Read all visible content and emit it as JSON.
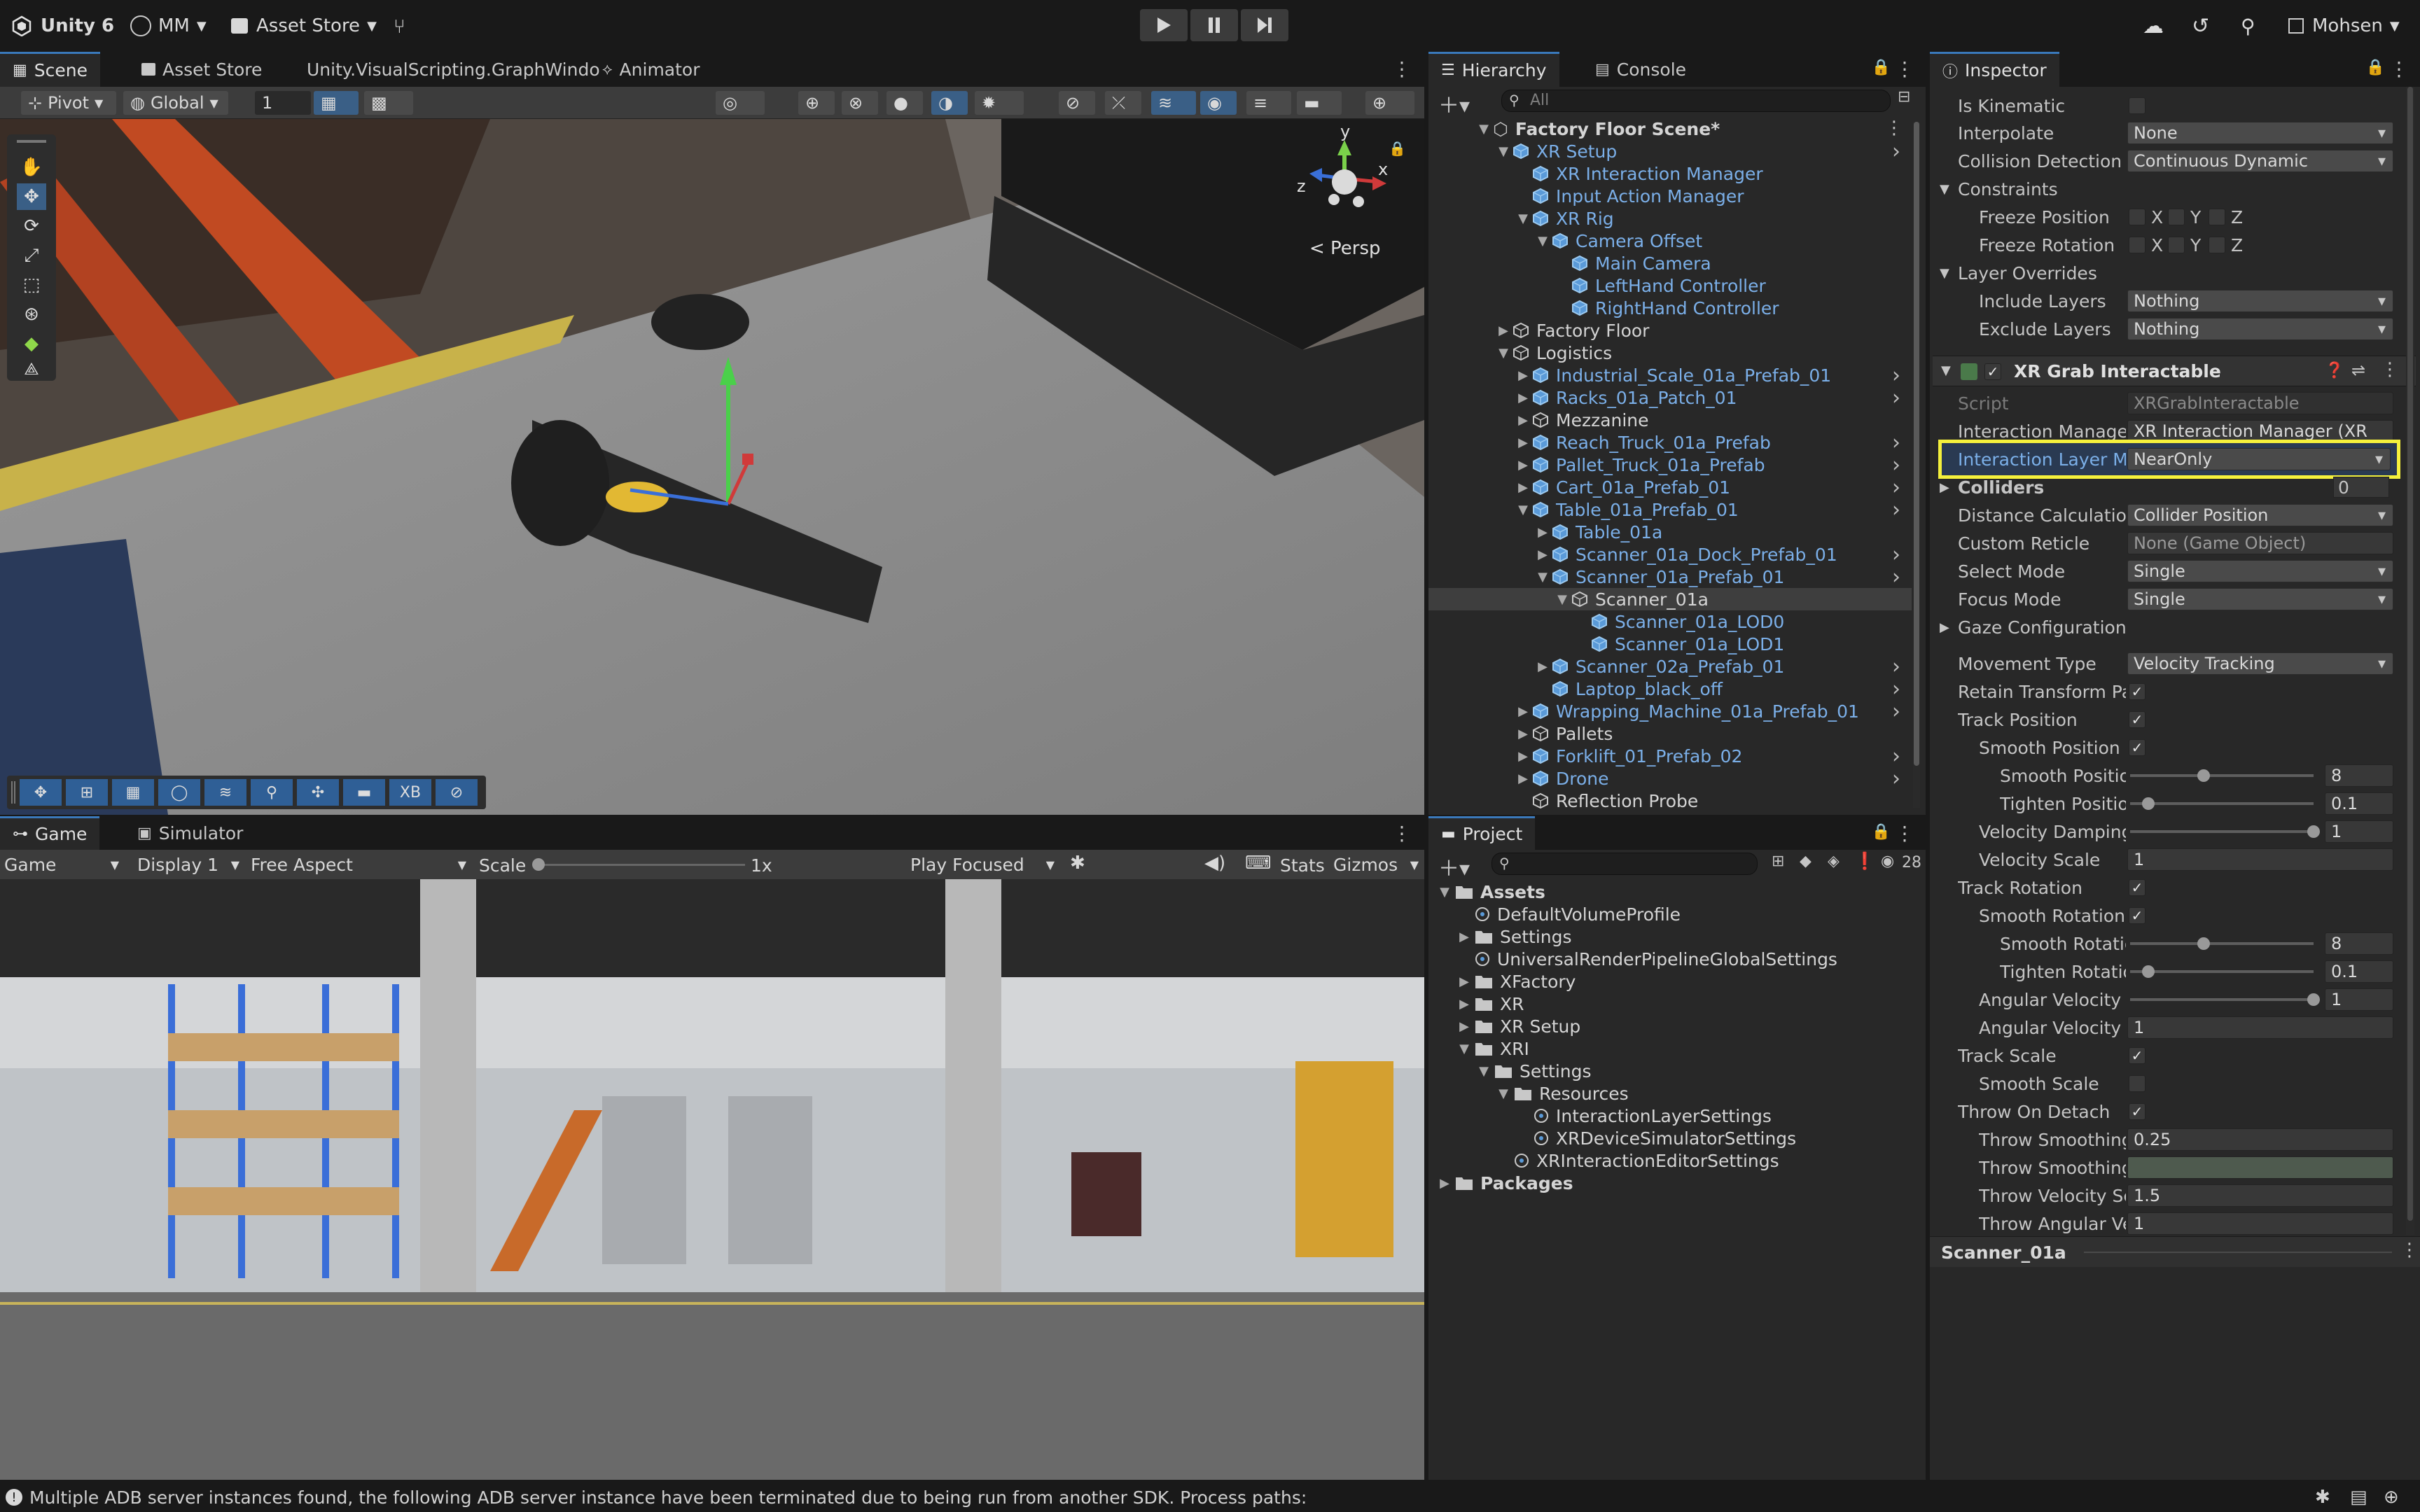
{
  "topbar": {
    "unity_label": "Unity 6",
    "account": "MM",
    "asset_store": "Asset Store",
    "user": "Mohsen"
  },
  "scene": {
    "tabs": [
      "Scene",
      "Asset Store",
      "Unity.VisualScripting.GraphWindo",
      "Animator"
    ],
    "pivot": "Pivot",
    "global": "Global",
    "grid_value": "1",
    "persp_label": "< Persp",
    "gizmo_y": "y",
    "gizmo_x": "x",
    "gizmo_z": "z",
    "overlay_xb": "XB"
  },
  "game": {
    "tabs": [
      "Game",
      "Simulator"
    ],
    "mode": "Game",
    "display": "Display 1",
    "aspect": "Free Aspect",
    "scale_label": "Scale",
    "scale_value": "1x",
    "play_focused": "Play Focused",
    "stats": "Stats",
    "gizmos": "Gizmos"
  },
  "hierarchy": {
    "tabs": [
      "Hierarchy",
      "Console"
    ],
    "search_placeholder": "All",
    "scene_name": "Factory Floor Scene*",
    "items": [
      {
        "label": "XR Setup",
        "depth": 1,
        "blue": true,
        "expand": "open",
        "chev": true
      },
      {
        "label": "XR Interaction Manager",
        "depth": 2,
        "blue": true,
        "expand": "none"
      },
      {
        "label": "Input Action Manager",
        "depth": 2,
        "blue": true,
        "expand": "none"
      },
      {
        "label": "XR Rig",
        "depth": 2,
        "blue": true,
        "expand": "open"
      },
      {
        "label": "Camera Offset",
        "depth": 3,
        "blue": true,
        "expand": "open"
      },
      {
        "label": "Main Camera",
        "depth": 4,
        "blue": true,
        "expand": "none"
      },
      {
        "label": "LeftHand Controller",
        "depth": 4,
        "blue": true,
        "expand": "none"
      },
      {
        "label": "RightHand Controller",
        "depth": 4,
        "blue": true,
        "expand": "none"
      },
      {
        "label": "Factory Floor",
        "depth": 1,
        "blue": false,
        "expand": "closed"
      },
      {
        "label": "Logistics",
        "depth": 1,
        "blue": false,
        "expand": "open"
      },
      {
        "label": "Industrial_Scale_01a_Prefab_01",
        "depth": 2,
        "blue": true,
        "expand": "closed",
        "chev": true
      },
      {
        "label": "Racks_01a_Patch_01",
        "depth": 2,
        "blue": true,
        "expand": "closed",
        "chev": true
      },
      {
        "label": "Mezzanine",
        "depth": 2,
        "blue": false,
        "expand": "closed"
      },
      {
        "label": "Reach_Truck_01a_Prefab",
        "depth": 2,
        "blue": true,
        "expand": "closed",
        "chev": true
      },
      {
        "label": "Pallet_Truck_01a_Prefab",
        "depth": 2,
        "blue": true,
        "expand": "closed",
        "chev": true
      },
      {
        "label": "Cart_01a_Prefab_01",
        "depth": 2,
        "blue": true,
        "expand": "closed",
        "chev": true
      },
      {
        "label": "Table_01a_Prefab_01",
        "depth": 2,
        "blue": true,
        "expand": "open",
        "chev": true
      },
      {
        "label": "Table_01a",
        "depth": 3,
        "blue": true,
        "expand": "closed"
      },
      {
        "label": "Scanner_01a_Dock_Prefab_01",
        "depth": 3,
        "blue": true,
        "expand": "closed",
        "chev": true
      },
      {
        "label": "Scanner_01a_Prefab_01",
        "depth": 3,
        "blue": true,
        "expand": "open",
        "chev": true
      },
      {
        "label": "Scanner_01a",
        "depth": 4,
        "blue": false,
        "expand": "open",
        "selected": true
      },
      {
        "label": "Scanner_01a_LOD0",
        "depth": 5,
        "blue": true,
        "expand": "none"
      },
      {
        "label": "Scanner_01a_LOD1",
        "depth": 5,
        "blue": true,
        "expand": "none"
      },
      {
        "label": "Scanner_02a_Prefab_01",
        "depth": 3,
        "blue": true,
        "expand": "closed",
        "chev": true
      },
      {
        "label": "Laptop_black_off",
        "depth": 3,
        "blue": true,
        "expand": "none",
        "chev": true
      },
      {
        "label": "Wrapping_Machine_01a_Prefab_01",
        "depth": 2,
        "blue": true,
        "expand": "closed",
        "chev": true
      },
      {
        "label": "Pallets",
        "depth": 2,
        "blue": false,
        "expand": "closed"
      },
      {
        "label": "Forklift_01_Prefab_02",
        "depth": 2,
        "blue": true,
        "expand": "closed",
        "chev": true
      },
      {
        "label": "Drone",
        "depth": 2,
        "blue": true,
        "expand": "closed",
        "chev": true
      },
      {
        "label": "Reflection Probe",
        "depth": 2,
        "blue": false,
        "expand": "none"
      }
    ]
  },
  "project": {
    "tab": "Project",
    "count": "28",
    "items": [
      {
        "label": "Assets",
        "depth": 0,
        "kind": "folder",
        "expand": "open",
        "bold": true
      },
      {
        "label": "DefaultVolumeProfile",
        "depth": 1,
        "kind": "asset",
        "expand": "none"
      },
      {
        "label": "Settings",
        "depth": 1,
        "kind": "folder",
        "expand": "closed"
      },
      {
        "label": "UniversalRenderPipelineGlobalSettings",
        "depth": 1,
        "kind": "asset",
        "expand": "none"
      },
      {
        "label": "XFactory",
        "depth": 1,
        "kind": "folder",
        "expand": "closed"
      },
      {
        "label": "XR",
        "depth": 1,
        "kind": "folder",
        "expand": "closed"
      },
      {
        "label": "XR Setup",
        "depth": 1,
        "kind": "folder",
        "expand": "closed"
      },
      {
        "label": "XRI",
        "depth": 1,
        "kind": "folder",
        "expand": "open"
      },
      {
        "label": "Settings",
        "depth": 2,
        "kind": "folder",
        "expand": "open"
      },
      {
        "label": "Resources",
        "depth": 3,
        "kind": "folder",
        "expand": "open"
      },
      {
        "label": "InteractionLayerSettings",
        "depth": 4,
        "kind": "asset",
        "expand": "none"
      },
      {
        "label": "XRDeviceSimulatorSettings",
        "depth": 4,
        "kind": "asset",
        "expand": "none"
      },
      {
        "label": "XRInteractionEditorSettings",
        "depth": 3,
        "kind": "asset",
        "expand": "none"
      },
      {
        "label": "Packages",
        "depth": 0,
        "kind": "folder",
        "expand": "closed",
        "bold": true
      }
    ]
  },
  "inspector": {
    "tab": "Inspector",
    "is_kinematic": "Is Kinematic",
    "interpolate": {
      "label": "Interpolate",
      "value": "None"
    },
    "collision": {
      "label": "Collision Detection",
      "value": "Continuous Dynamic"
    },
    "constraints": "Constraints",
    "freeze_position": "Freeze Position",
    "freeze_rotation": "Freeze Rotation",
    "axis_x": "X",
    "axis_y": "Y",
    "axis_z": "Z",
    "layer_overrides": "Layer Overrides",
    "include_layers": {
      "label": "Include Layers",
      "value": "Nothing"
    },
    "exclude_layers": {
      "label": "Exclude Layers",
      "value": "Nothing"
    },
    "component": "XR Grab Interactable",
    "script": {
      "label": "Script",
      "value": "XRGrabInteractable"
    },
    "interaction_manager": {
      "label": "Interaction Manager",
      "value": "XR Interaction Manager (XR"
    },
    "interaction_layer_mask": {
      "label": "Interaction Layer Mas",
      "value": "NearOnly"
    },
    "colliders": {
      "label": "Colliders",
      "value": "0"
    },
    "distance_calc": {
      "label": "Distance Calculation",
      "value": "Collider Position"
    },
    "custom_reticle": {
      "label": "Custom Reticle",
      "value": "None (Game Object)"
    },
    "select_mode": {
      "label": "Select Mode",
      "value": "Single"
    },
    "focus_mode": {
      "label": "Focus Mode",
      "value": "Single"
    },
    "gaze_config": "Gaze Configuration",
    "movement_type": {
      "label": "Movement Type",
      "value": "Velocity Tracking"
    },
    "retain_transform": "Retain Transform Par",
    "track_position": "Track Position",
    "smooth_position": "Smooth Position",
    "smooth_position_amt": {
      "label": "Smooth Positior",
      "value": "8",
      "level": 0.4
    },
    "tighten_position": {
      "label": "Tighten Positior",
      "value": "0.1",
      "level": 0.1
    },
    "velocity_damping": {
      "label": "Velocity Damping",
      "value": "1",
      "level": 1.0
    },
    "velocity_scale": {
      "label": "Velocity Scale",
      "value": "1"
    },
    "track_rotation": "Track Rotation",
    "smooth_rotation": "Smooth Rotation",
    "smooth_rotation_amt": {
      "label": "Smooth Rotatio",
      "value": "8",
      "level": 0.4
    },
    "tighten_rotation": {
      "label": "Tighten Rotatio",
      "value": "0.1",
      "level": 0.1
    },
    "angular_velocity_damping": {
      "label": "Angular Velocity D",
      "value": "1",
      "level": 1.0
    },
    "angular_velocity_scale": {
      "label": "Angular Velocity S",
      "value": "1"
    },
    "track_scale": "Track Scale",
    "smooth_scale": "Smooth Scale",
    "throw_on_detach": "Throw On Detach",
    "throw_smoothing_1": {
      "label": "Throw Smoothing",
      "value": "0.25"
    },
    "throw_smoothing_2": {
      "label": "Throw Smoothing",
      "value": ""
    },
    "throw_velocity_scale": {
      "label": "Throw Velocity Sca",
      "value": "1.5"
    },
    "throw_angular_vel": {
      "label": "Throw Angular Vel",
      "value": "1"
    },
    "footer_object": "Scanner_01a"
  },
  "status": {
    "message": "Multiple ADB server instances found, the following ADB server instance have been terminated due to being run from another SDK. Process paths:"
  },
  "colors": {
    "accent": "#3a79bb",
    "highlight": "#f4f03c",
    "prefab_blue": "#7bafe8"
  }
}
